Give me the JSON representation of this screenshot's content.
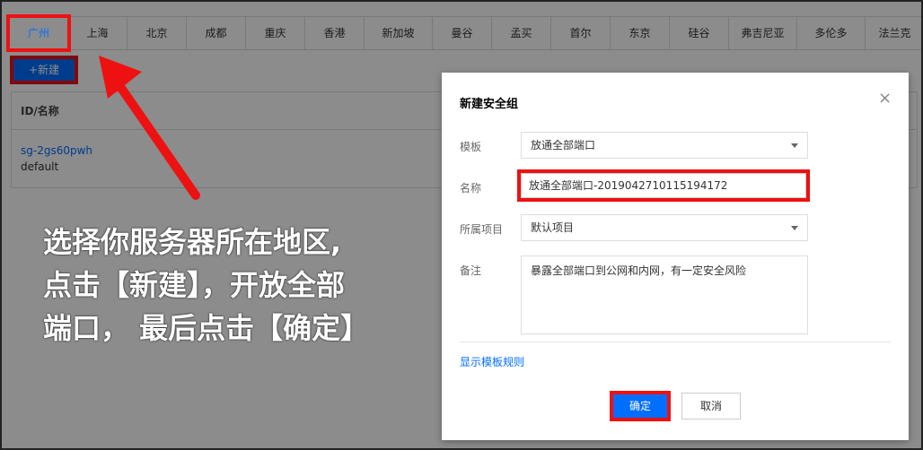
{
  "regions": [
    "广州",
    "上海",
    "北京",
    "成都",
    "重庆",
    "香港",
    "新加坡",
    "曼谷",
    "孟买",
    "首尔",
    "东京",
    "硅谷",
    "弗吉尼亚",
    "多伦多",
    "法兰克"
  ],
  "toolbar": {
    "new_label": "+新建"
  },
  "table": {
    "header": "ID/名称",
    "rows": [
      {
        "id": "sg-2gs60pwh",
        "name": "default"
      }
    ]
  },
  "annotation": {
    "line1": "选择你服务器所在地区,",
    "line2": "点击【新建】，开放全部",
    "line3": "端口， 最后点击【确定】"
  },
  "modal": {
    "title": "新建安全组",
    "template_label": "模板",
    "template_value": "放通全部端口",
    "name_label": "名称",
    "name_value": "放通全部端口-2019042710115194172",
    "project_label": "所属项目",
    "project_value": "默认项目",
    "remark_label": "备注",
    "remark_value": "暴露全部端口到公网和内网，有一定安全风险",
    "show_rules_link": "显示模板规则",
    "ok_label": "确定",
    "cancel_label": "取消"
  },
  "colors": {
    "accent": "#006eff",
    "highlight": "#ee1111"
  }
}
